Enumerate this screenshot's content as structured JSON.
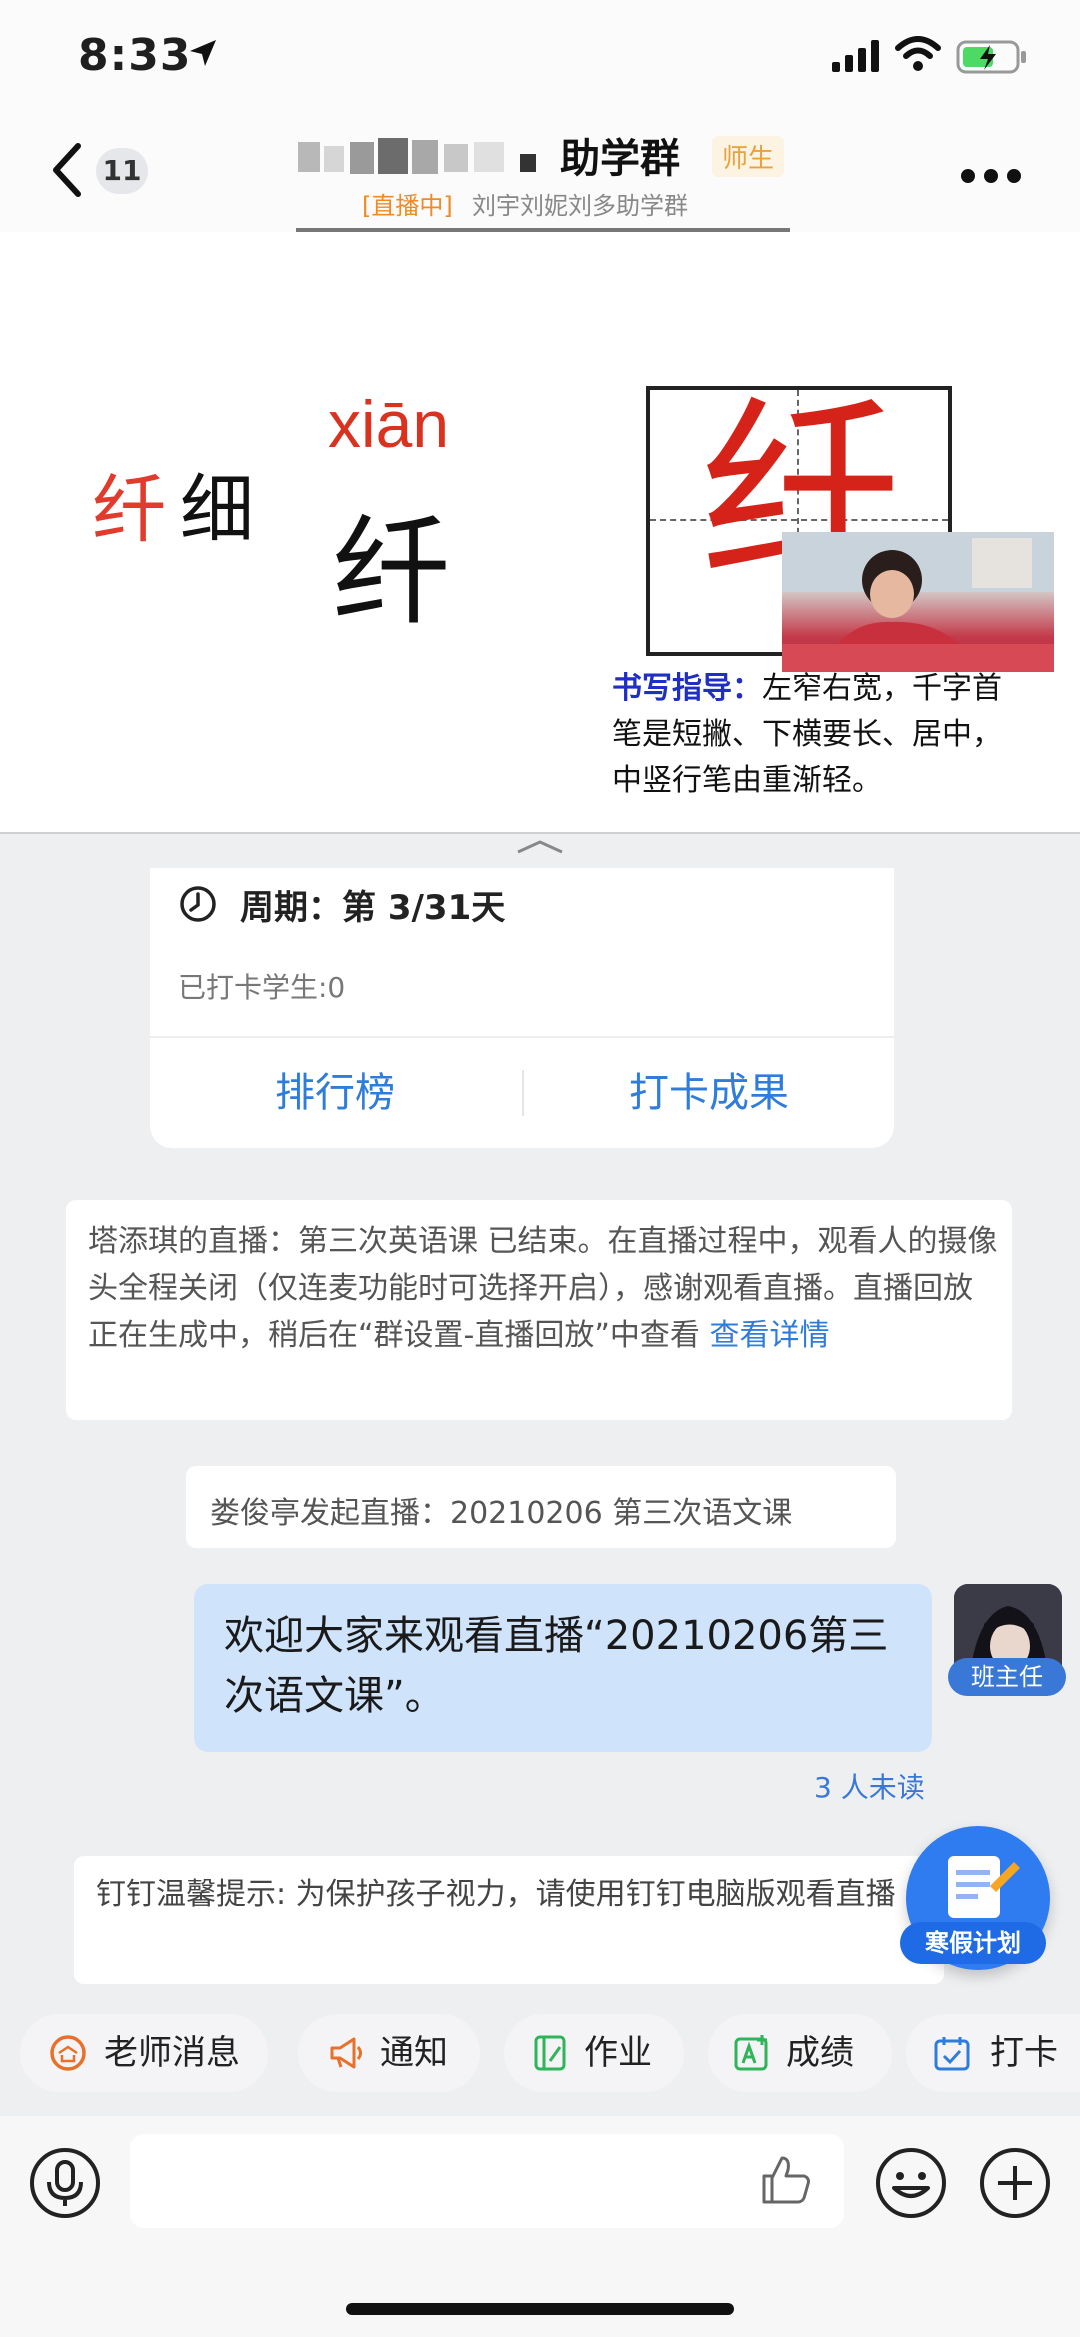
{
  "status_bar": {
    "time": "8:33"
  },
  "nav": {
    "unread_count": "11",
    "group_title": "助学群",
    "role_badge": "师生",
    "live_tag": "[直播中]",
    "live_subtitle": "刘宇刘妮刘多助学群"
  },
  "video": {
    "word_red": "纤",
    "word_black": "细",
    "pinyin": "xiān",
    "big_char": "纤",
    "grid_char": "纤",
    "guide_label": "书写指导：",
    "guide_text": "左窄右宽，千字首笔是短撇、下横要长、居中，中竖行笔由重渐轻。"
  },
  "checkin": {
    "period_label": "周期：第 3/31天",
    "checked_count": "已打卡学生:0",
    "rank_button": "排行榜",
    "result_button": "打卡成果"
  },
  "notice": {
    "text": "塔添琪的直播：第三次英语课 已结束。在直播过程中，观看人的摄像头全程关闭（仅连麦功能时可选择开启），感谢观看直播。直播回放正在生成中，稍后在“群设置-直播回放”中查看",
    "link": "查看详情"
  },
  "live_start": "娄俊亭发起直播：20210206 第三次语文课",
  "message": {
    "text": "欢迎大家来观看直播“20210206第三次语文课”。",
    "sender_tag": "班主任",
    "read_status": "3 人未读"
  },
  "tip": "钉钉温馨提示: 为保护孩子视力，请使用钉钉电脑版观看直播",
  "fab_label": "寒假计划",
  "quick_actions": [
    {
      "label": "老师消息",
      "icon": "teacher-icon",
      "color": "#e8702a"
    },
    {
      "label": "通知",
      "icon": "megaphone-icon",
      "color": "#e8702a"
    },
    {
      "label": "作业",
      "icon": "homework-icon",
      "color": "#2fb45a"
    },
    {
      "label": "成绩",
      "icon": "grade-icon",
      "color": "#2fb45a"
    },
    {
      "label": "打卡",
      "icon": "calendar-check-icon",
      "color": "#2f7cdb"
    }
  ],
  "colors": {
    "accent": "#2f7cdb",
    "bubble": "#cfe3fb",
    "live": "#f08a24"
  }
}
